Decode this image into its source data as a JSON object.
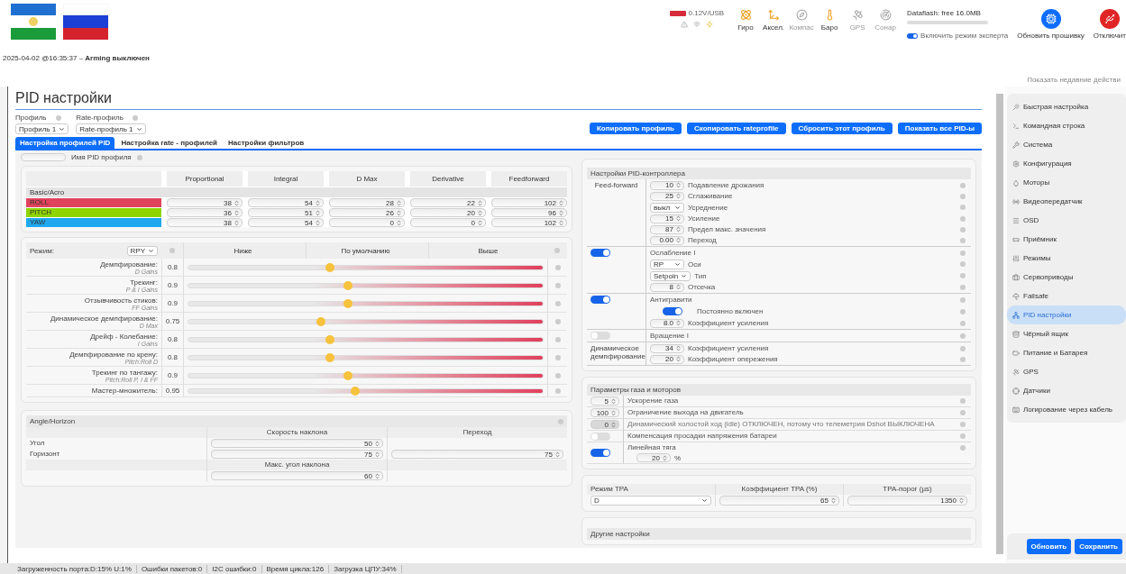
{
  "header": {
    "battery": "0.12V/USB",
    "sensors": [
      {
        "label": "Гиро",
        "active": true
      },
      {
        "label": "Аксел.",
        "active": true
      },
      {
        "label": "Компас",
        "active": false
      },
      {
        "label": "Баро",
        "active": true
      },
      {
        "label": "GPS",
        "active": false
      },
      {
        "label": "Сонар",
        "active": false
      }
    ],
    "dataflash": "Dataflash: free 16.0MB",
    "expert_mode": {
      "label": "Включить режим эксперта",
      "on": true
    },
    "buttons": [
      {
        "label": "Обновить прошивку",
        "kind": "firmware"
      },
      {
        "label": "Отключит",
        "kind": "disconnect"
      }
    ]
  },
  "status_line": "2025-04-02 @16:35:37 – **Arming выключен**",
  "show_log": "Показать недавние действи",
  "title": "PID настройки",
  "profiles": [
    {
      "label": "Профиль",
      "value": "Профиль 1"
    },
    {
      "label": "Rate-профиль",
      "value": "Rate-профиль 1"
    }
  ],
  "actions": [
    "Копировать профиль",
    "Скопировать rateprofile",
    "Сбросить этот профиль",
    "Показать все PID-ы"
  ],
  "tabs": [
    {
      "label": "Настройка профилей PID",
      "selected": true
    },
    {
      "label": "Настройка rate - профилей",
      "selected": false
    },
    {
      "label": "Настройки фильтров",
      "selected": false
    }
  ],
  "pid_name_label": "Имя PID профиля",
  "pid_table": {
    "columns": [
      "Proportional",
      "Integral",
      "D Max",
      "Derivative",
      "Feedforward"
    ],
    "group": "Basic/Acro",
    "rows": [
      {
        "axis": "ROLL",
        "color": "#e0435c",
        "values": [
          "38",
          "54",
          "28",
          "22",
          "102"
        ]
      },
      {
        "axis": "PITCH",
        "color": "#8fd400",
        "values": [
          "36",
          "51",
          "26",
          "20",
          "96"
        ]
      },
      {
        "axis": "YAW",
        "color": "#1fa8f0",
        "values": [
          "38",
          "54",
          "0",
          "0",
          "102"
        ]
      }
    ]
  },
  "sliders": {
    "mode_label": "Режим:",
    "mode": "RPY",
    "columns": [
      "Ниже",
      "По умолчанию",
      "Выше"
    ],
    "rows": [
      {
        "label": "Демпфирование:",
        "sub": "D Gains",
        "value": "0.8",
        "level": 0.4
      },
      {
        "label": "Трекинг:",
        "sub": "P & I Gains",
        "value": "0.9",
        "level": 0.45
      },
      {
        "label": "Отзывчивость стиков:",
        "sub": "FF Gains",
        "value": "0.9",
        "level": 0.45
      },
      {
        "label": "Динамическое демпфирование:",
        "sub": "D Max",
        "value": "0.75",
        "level": 0.375
      },
      {
        "label": "Дрейф - Колебание:",
        "sub": "I Gains",
        "value": "0.8",
        "level": 0.4
      },
      {
        "label": "Демпфирование по крену:",
        "sub": "Pitch:Roll D",
        "value": "0.8",
        "level": 0.4
      },
      {
        "label": "Трекинг по тангажу:",
        "sub": "Pitch:Roll P, I & FF",
        "value": "0.9",
        "level": 0.45
      },
      {
        "label": "Мастер-множитель:",
        "value": "0.95",
        "level": 0.47
      }
    ]
  },
  "angle_horizon": {
    "title": "Angle/Horizon",
    "columns": [
      "Скорость наклона",
      "Переход"
    ],
    "rows": [
      {
        "label": "Угол",
        "rate": "50"
      },
      {
        "label": "Горизонт",
        "rate": "75",
        "transition": "75"
      }
    ],
    "max_title": "Макс. угол наклона",
    "max_value": "60"
  },
  "pid_controller": {
    "title": "Настройки PID-контроллера",
    "groups": [
      {
        "kind": "label",
        "label": "Feed-forward",
        "rows": [
          {
            "kind": "number",
            "value": "10",
            "label": "Подавление дрожания"
          },
          {
            "kind": "number",
            "value": "25",
            "label": "Сглаживание"
          },
          {
            "kind": "select",
            "value": "выкл",
            "label": "Усреднение"
          },
          {
            "kind": "number",
            "value": "15",
            "label": "Усиление"
          },
          {
            "kind": "number",
            "value": "87",
            "label": "Предел макс. значения"
          },
          {
            "kind": "number",
            "value": "0.00",
            "label": "Переход"
          }
        ]
      },
      {
        "kind": "switch",
        "on": true,
        "label": "Ослабление I",
        "rows": [
          {
            "kind": "select",
            "value": "RP",
            "label": "Оси"
          },
          {
            "kind": "select",
            "value": "Setpoin",
            "label": "Тип"
          },
          {
            "kind": "number",
            "value": "8",
            "label": "Отсечка"
          }
        ]
      },
      {
        "kind": "switch",
        "on": true,
        "label": "Антигравити",
        "rows": [
          {
            "kind": "switch",
            "on": true,
            "label": "Постоянно включен"
          },
          {
            "kind": "number",
            "value": "8.0",
            "label": "Коэффициент усиления"
          }
        ]
      },
      {
        "kind": "switch",
        "on": false,
        "label": "Вращение I"
      },
      {
        "kind": "label",
        "label": "Динамическое демпфирование",
        "rows": [
          {
            "kind": "number",
            "value": "34",
            "label": "Коэффициент усиления"
          },
          {
            "kind": "number",
            "value": "20",
            "label": "Коэффициент опережения"
          }
        ]
      }
    ]
  },
  "throttle": {
    "title": "Параметры газа и моторов",
    "rows": [
      {
        "kind": "number",
        "value": "5",
        "disabled": false,
        "label": "Ускорение газа"
      },
      {
        "kind": "number",
        "value": "100",
        "disabled": false,
        "label": "Ограничение выхода на двигатель"
      },
      {
        "kind": "number",
        "value": "0",
        "disabled": true,
        "label": "Динамический холостой ход (idle) ОТКЛЮЧЕН, потому что телеметрия Dshot ВЫКЛЮЧЕНА"
      },
      {
        "kind": "switch",
        "on": false,
        "label": "Компенсация просадки напряжения батареи"
      },
      {
        "kind": "switch",
        "on": true,
        "label": "Линейная тяга",
        "percent": "20",
        "unit": "%"
      }
    ]
  },
  "tpa": [
    {
      "title": "Режим TPA",
      "kind": "select",
      "value": "D"
    },
    {
      "title": "Коэффициент TPA (%)",
      "kind": "number",
      "value": "65"
    },
    {
      "title": "TPA-порог (µs)",
      "kind": "number",
      "value": "1350"
    }
  ],
  "other_title": "Другие настройки",
  "sidebar": {
    "items": [
      {
        "label": "Быстрая настройка",
        "selected": false
      },
      {
        "label": "Командная строка",
        "selected": false
      },
      {
        "label": "Система",
        "selected": false
      },
      {
        "label": "Конфигурация",
        "selected": false
      },
      {
        "label": "Моторы",
        "selected": false
      },
      {
        "label": "Видеопередатчик",
        "selected": false
      },
      {
        "label": "OSD",
        "selected": false
      },
      {
        "label": "Приёмник",
        "selected": false
      },
      {
        "label": "Режимы",
        "selected": false
      },
      {
        "label": "Сервоприводы",
        "selected": false
      },
      {
        "label": "Failsafe",
        "selected": false
      },
      {
        "label": "PID настройки",
        "selected": true
      },
      {
        "label": "Чёрный ящик",
        "selected": false
      },
      {
        "label": "Питание и Батарея",
        "selected": false
      },
      {
        "label": "GPS",
        "selected": false
      },
      {
        "label": "Датчики",
        "selected": false
      },
      {
        "label": "Логирование через кабель",
        "selected": false
      }
    ],
    "buttons": [
      "Обновить",
      "Сохранить"
    ]
  },
  "status_bar": [
    "Загруженность порта:D:15% U:1%",
    "Ошибки пакетов:0",
    "I2C ошибки:0",
    "Время цикла:126",
    "Загрузка ЦПУ:34%"
  ]
}
